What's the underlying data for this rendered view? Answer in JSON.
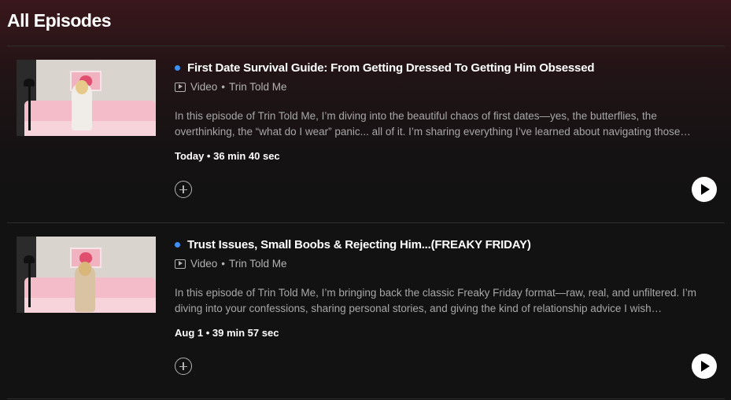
{
  "heading": "All Episodes",
  "colors": {
    "unplayed_dot": "#3d91f4",
    "background": "#121212",
    "header_tint": "#3a171c"
  },
  "episodes": [
    {
      "title": "First Date Survival Guide: From Getting Dressed To Getting Him Obsessed",
      "type": "Video",
      "separator": "•",
      "show": "Trin Told Me",
      "description": "In this episode of Trin Told Me, I’m diving into the beautiful chaos of first dates—yes, the butterflies, the overthinking, the “what do I wear” panic... all of it. I’m sharing everything I’ve learned about navigating those…",
      "date_duration": "Today • 36 min 40 sec",
      "icons": {
        "type_icon": "video-icon",
        "add": "add-circle-icon",
        "play": "play-icon"
      }
    },
    {
      "title": "Trust Issues, Small Boobs & Rejecting Him...(FREAKY FRIDAY)",
      "type": "Video",
      "separator": "•",
      "show": "Trin Told Me",
      "description": "In this episode of Trin Told Me, I’m bringing back the classic Freaky Friday format—raw, real, and unfiltered. I’m diving into your confessions, sharing personal stories, and giving the kind of relationship advice I wish…",
      "date_duration": "Aug 1 • 39 min 57 sec",
      "icons": {
        "type_icon": "video-icon",
        "add": "add-circle-icon",
        "play": "play-icon"
      }
    }
  ]
}
